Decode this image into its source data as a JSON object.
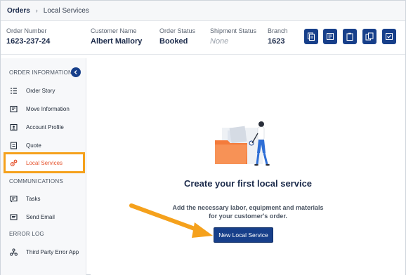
{
  "breadcrumb": {
    "root": "Orders",
    "separator": "›",
    "current": "Local Services"
  },
  "order_header": {
    "fields": [
      {
        "label": "Order Number",
        "value": "1623-237-24"
      },
      {
        "label": "Customer Name",
        "value": "Albert Mallory"
      },
      {
        "label": "Order Status",
        "value": "Booked"
      },
      {
        "label": "Shipment Status",
        "value": "None"
      },
      {
        "label": "Branch",
        "value": "1623"
      }
    ],
    "action_icons": [
      "copy-document-icon",
      "notes-icon",
      "clipboard-icon",
      "duplicate-icon",
      "checklist-icon"
    ]
  },
  "sidebar": {
    "sections": [
      {
        "title": "ORDER INFORMATION"
      },
      {
        "title": "COMMUNICATIONS"
      },
      {
        "title": "ERROR LOG"
      }
    ],
    "items": [
      {
        "label": "Order Story",
        "icon": "list-icon"
      },
      {
        "label": "Move Information",
        "icon": "info-card-icon"
      },
      {
        "label": "Account Profile",
        "icon": "profile-card-icon"
      },
      {
        "label": "Quote",
        "icon": "quote-document-icon"
      },
      {
        "label": "Local Services",
        "icon": "gears-icon",
        "active": true
      },
      {
        "label": "Tasks",
        "icon": "tasks-icon"
      },
      {
        "label": "Send Email",
        "icon": "email-icon"
      },
      {
        "label": "Third Party Error App",
        "icon": "network-icon"
      }
    ]
  },
  "empty_state": {
    "title": "Create your first local service",
    "description_line1": "Add the necessary labor, equipment and materials",
    "description_line2": "for your customer's order.",
    "button_label": "New Local Service",
    "illustration": "person-with-folder-illustration"
  },
  "colors": {
    "brand_navy": "#173f8a",
    "active_text": "#e5532d",
    "highlight_orange": "#f5a11c",
    "folder_orange": "#f47b3b"
  }
}
